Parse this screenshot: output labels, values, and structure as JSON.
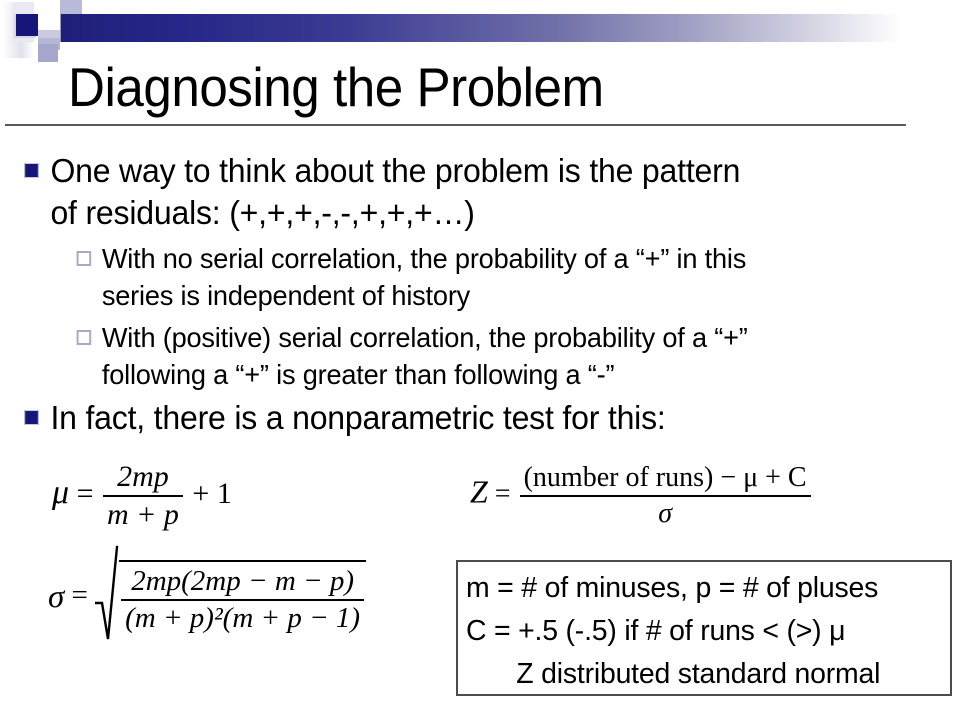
{
  "slide": {
    "title": "Diagnosing the Problem"
  },
  "bullets": [
    {
      "level": 1,
      "marker": "filled-square",
      "lines": [
        "One way to think about the problem is the pattern",
        "of residuals: (+,+,+,-,-,+,+,+…)"
      ]
    },
    {
      "level": 2,
      "marker": "hollow-square",
      "lines": [
        "With no serial correlation, the probability of a “+” in this",
        "series is independent of history"
      ]
    },
    {
      "level": 2,
      "marker": "hollow-square",
      "lines": [
        "With (positive) serial correlation, the probability of a “+”",
        "following a “+” is greater than following a “-”"
      ]
    },
    {
      "level": 1,
      "marker": "filled-square",
      "lines": [
        "In fact, there is a nonparametric test for this:"
      ]
    }
  ],
  "formulas": {
    "mu": {
      "lhs": "μ",
      "eq": "=",
      "numerator": "2mp",
      "denominator": "m + p",
      "trailing": "+ 1"
    },
    "sigma": {
      "lhs": "σ",
      "eq": "=",
      "numerator": "2mp(2mp − m − p)",
      "numerator_parts": {
        "a": "2mp",
        "b": "(2mp − m − p)"
      },
      "denominator_parts": {
        "a": "(m + p)",
        "exp": "2",
        "b": "(m + p − 1)"
      },
      "denominator": "(m + p)²(m + p − 1)"
    },
    "z": {
      "lhs": "Z",
      "eq": "=",
      "numerator": "(number of runs) − μ + C",
      "numerator_parts": {
        "paren_open": "(",
        "text": "number of runs",
        "paren_close": ")",
        "tail": "− μ + C"
      },
      "denominator": "σ"
    }
  },
  "legend": {
    "lines": [
      "m = # of minuses, p = # of pluses",
      "C = +.5 (-.5) if  # of runs < (>) μ",
      "Z distributed standard normal"
    ]
  },
  "colors": {
    "bullet_marker": "#16167a",
    "sub_marker_border": "#a9a9c4",
    "gradient_start": "#1f1f7a",
    "gradient_end": "#ffffff",
    "title_rule": "#595964",
    "legend_border": "#4c4c4c"
  }
}
